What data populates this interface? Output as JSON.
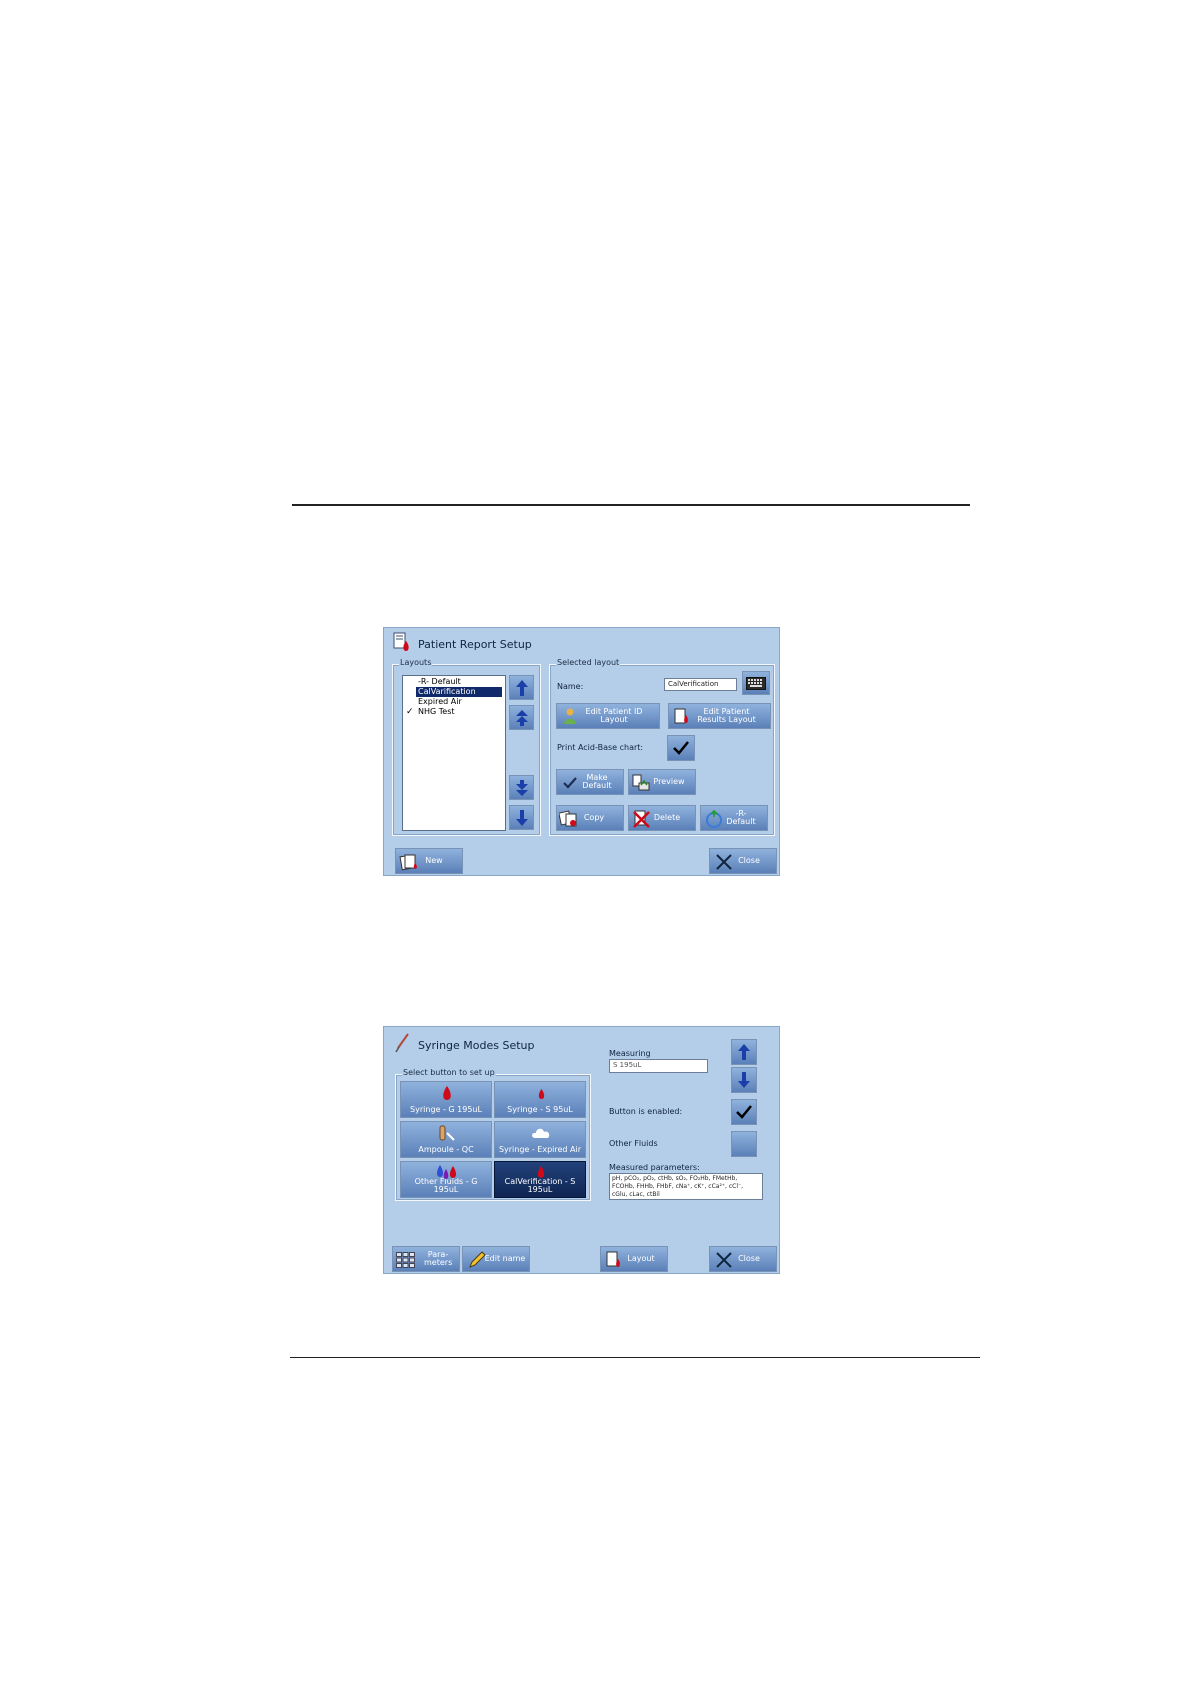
{
  "patient_report_setup": {
    "title": "Patient Report Setup",
    "layouts_group_label": "Layouts",
    "layouts": [
      {
        "label": "-R- Default",
        "selected": false,
        "checked": false
      },
      {
        "label": "CalVarification",
        "selected": true,
        "checked": false
      },
      {
        "label": "Expired Air",
        "selected": false,
        "checked": false
      },
      {
        "label": "NHG Test",
        "selected": false,
        "checked": true
      }
    ],
    "selected_group_label": "Selected layout",
    "name_label": "Name:",
    "name_value": "CalVerification",
    "edit_patient_id_label": "Edit Patient ID Layout",
    "edit_patient_results_label": "Edit Patient Results Layout",
    "print_acid_base_label": "Print Acid-Base chart:",
    "make_default_label": "Make Default",
    "preview_label": "Preview",
    "copy_label": "Copy",
    "delete_label": "Delete",
    "r_default_label": "-R- Default",
    "new_label": "New",
    "close_label": "Close"
  },
  "syringe_modes_setup": {
    "title": "Syringe Modes Setup",
    "select_group_label": "Select button to set up",
    "mode_buttons": [
      {
        "label": "Syringe - G 195uL",
        "icon": "blood-drop-icon",
        "selected": false
      },
      {
        "label": "Syringe - S 95uL",
        "icon": "small-blood-drop-icon",
        "selected": false
      },
      {
        "label": "Ampoule - QC",
        "icon": "ampoule-icon",
        "selected": false
      },
      {
        "label": "Syringe - Expired Air",
        "icon": "cloud-icon",
        "selected": false
      },
      {
        "label": "Other Fluids - G 195uL",
        "icon": "multi-drop-icon",
        "selected": false
      },
      {
        "label": "CalVerification - S 195uL",
        "icon": "blood-drop-icon",
        "selected": true
      }
    ],
    "measuring_label": "Measuring",
    "measuring_value": "S 195uL",
    "button_enabled_label": "Button is enabled:",
    "other_fluids_label": "Other Fluids",
    "measured_params_label": "Measured parameters:",
    "measured_params_value": "pH, pCO₂, pO₂, ctHb, sO₂, FO₂Hb, FMetHb, FCOHb, FHHb, FHbF, cNa⁺, cK⁺, cCa²⁺, cCl⁻, cGlu, cLac, ctBil",
    "parameters_label": "Para-meters",
    "edit_name_label": "Edit name",
    "layout_label": "Layout",
    "close_label": "Close"
  },
  "colors": {
    "panel_bg": "#b4cde8",
    "button_top": "#8fb2dd",
    "button_bottom": "#5b80b8",
    "selected_dark": "#10296a"
  }
}
